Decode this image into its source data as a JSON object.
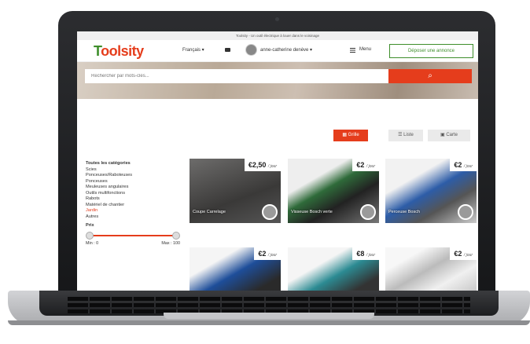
{
  "topbar": {
    "text": "Toolsity - Un outil électrique à louer dans le voisinage"
  },
  "header": {
    "logo": "Toolsity",
    "language": "Français ▾",
    "user_name": "anne-catherine denève ▾",
    "menu_label": "Menu",
    "deposit_button": "Déposer une annonce"
  },
  "search": {
    "placeholder": "Rechercher par mots-clés...",
    "button_icon": "search-icon"
  },
  "view_toggle": {
    "grid": "Grille",
    "list": "Liste",
    "map": "Carte"
  },
  "sidebar": {
    "heading": "Toutes les catégories",
    "categories": [
      "Scies",
      "Ponceuses/Raboteuses",
      "Ponceuses",
      "Meuleuses angulaires",
      "Outils multifonctions",
      "Rabots",
      "Matériel de chantier",
      "Jardin",
      "Autres"
    ],
    "active_category": "Jardin",
    "price_title": "Prix",
    "price_min": 0,
    "price_max": 100,
    "min_label": "Min : 0",
    "max_label": "Max : 100"
  },
  "listings": [
    {
      "price": "€2,50",
      "unit": "/ jour",
      "title": "Coupe Carrelage"
    },
    {
      "price": "€2",
      "unit": "/ jour",
      "title": "Visseuse Bosch verte"
    },
    {
      "price": "€2",
      "unit": "/ jour",
      "title": "Perceuse Bosch"
    },
    {
      "price": "€2",
      "unit": "/ jour",
      "title": ""
    },
    {
      "price": "€8",
      "unit": "/ jour",
      "title": ""
    },
    {
      "price": "€2",
      "unit": "/ jour",
      "title": ""
    }
  ],
  "colors": {
    "brand_red": "#e53d1c",
    "brand_green": "#3e8e2b"
  }
}
